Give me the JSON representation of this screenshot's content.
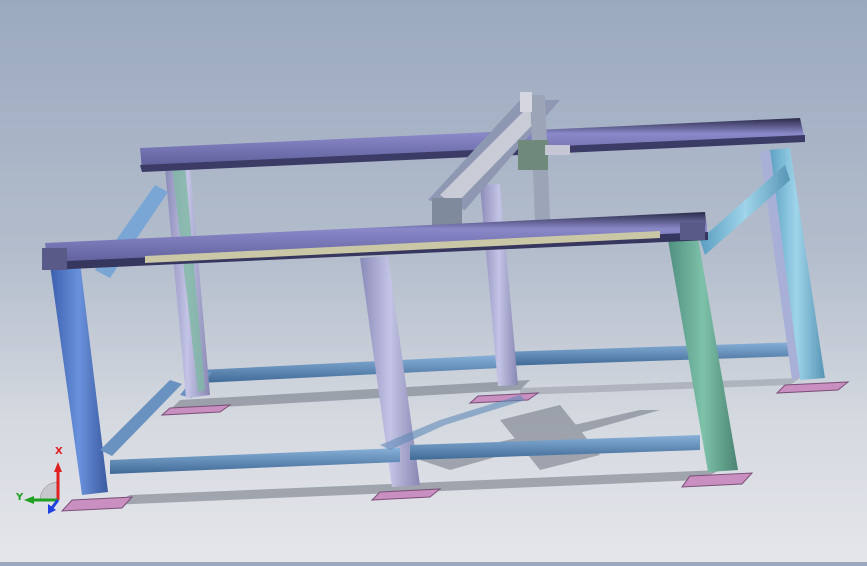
{
  "viewport": {
    "background_top": "#9ba9bf",
    "background_bottom": "#e4e6ea",
    "model_description_colors": {
      "beam_top": "#7f7fbf",
      "beam_dark": "#3a3a6a",
      "leg_blue": "#5a7fc8",
      "leg_green": "#6fae9a",
      "leg_lavender": "#a9a9d6",
      "leg_cyan": "#7cc0d8",
      "cross_beam": "#5f88b5",
      "foot_pad": "#c88fc0",
      "shadow": "#6f7581"
    }
  },
  "triad": {
    "x_label": "X",
    "y_label": "Y",
    "x_color": "#e02020",
    "y_color": "#20a020",
    "z_color": "#2040e0"
  }
}
